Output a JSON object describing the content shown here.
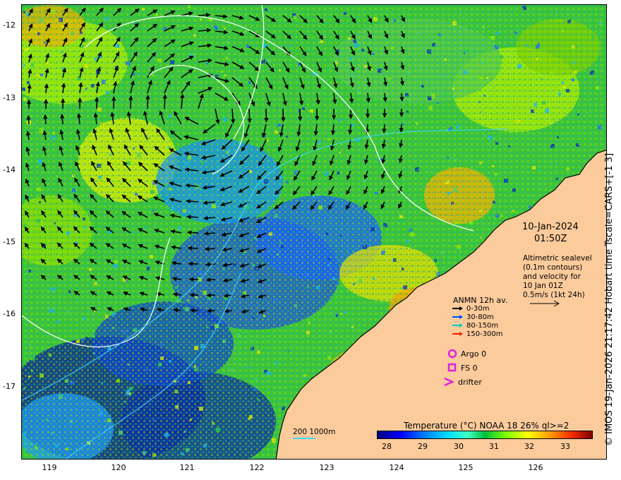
{
  "map": {
    "y_ticks": [
      "-12",
      "-13",
      "-14",
      "-15",
      "-16",
      "-17"
    ],
    "x_ticks": [
      "119",
      "120",
      "121",
      "122",
      "123",
      "124",
      "125",
      "126"
    ],
    "lat_range": [
      -17.97,
      -11.73
    ],
    "lon_range": [
      118.6,
      126.95
    ],
    "land_color": "#fccb9c",
    "arrow_color": "#000000",
    "contour_color": "#ffffff",
    "isobath_color": "#40d8ff"
  },
  "annotations": {
    "date": "10-Jan-2024",
    "time": "01:50Z",
    "altimetry_lines": [
      "Altimetric sealevel",
      "(0.1m contours)",
      "and velocity for",
      "10 Jan 01Z",
      "0.5m/s (1kt 24h)"
    ]
  },
  "legend": {
    "title": "ANMN 12h av.",
    "items": [
      {
        "label": "0-30m",
        "color": "#000000"
      },
      {
        "label": "30-80m",
        "color": "#0050ff"
      },
      {
        "label": "80-150m",
        "color": "#00c8c8"
      },
      {
        "label": "150-300m",
        "color": "#ff2000"
      }
    ],
    "argo": "Argo 0",
    "fs": "FS 0",
    "drifter": "drifter",
    "symbol_color": "#e020e0"
  },
  "colorbar": {
    "title": "Temperature (°C) NOAA 18 26% ql>=2",
    "ticks": [
      "28",
      "29",
      "30",
      "31",
      "32",
      "33"
    ],
    "range": [
      27.6,
      33.9
    ]
  },
  "depth_legend": "200  1000m",
  "credit": "© IMOS 19-Jan-2026 21:17:42 Hobart time Tscale=CARS+[-1 3]"
}
